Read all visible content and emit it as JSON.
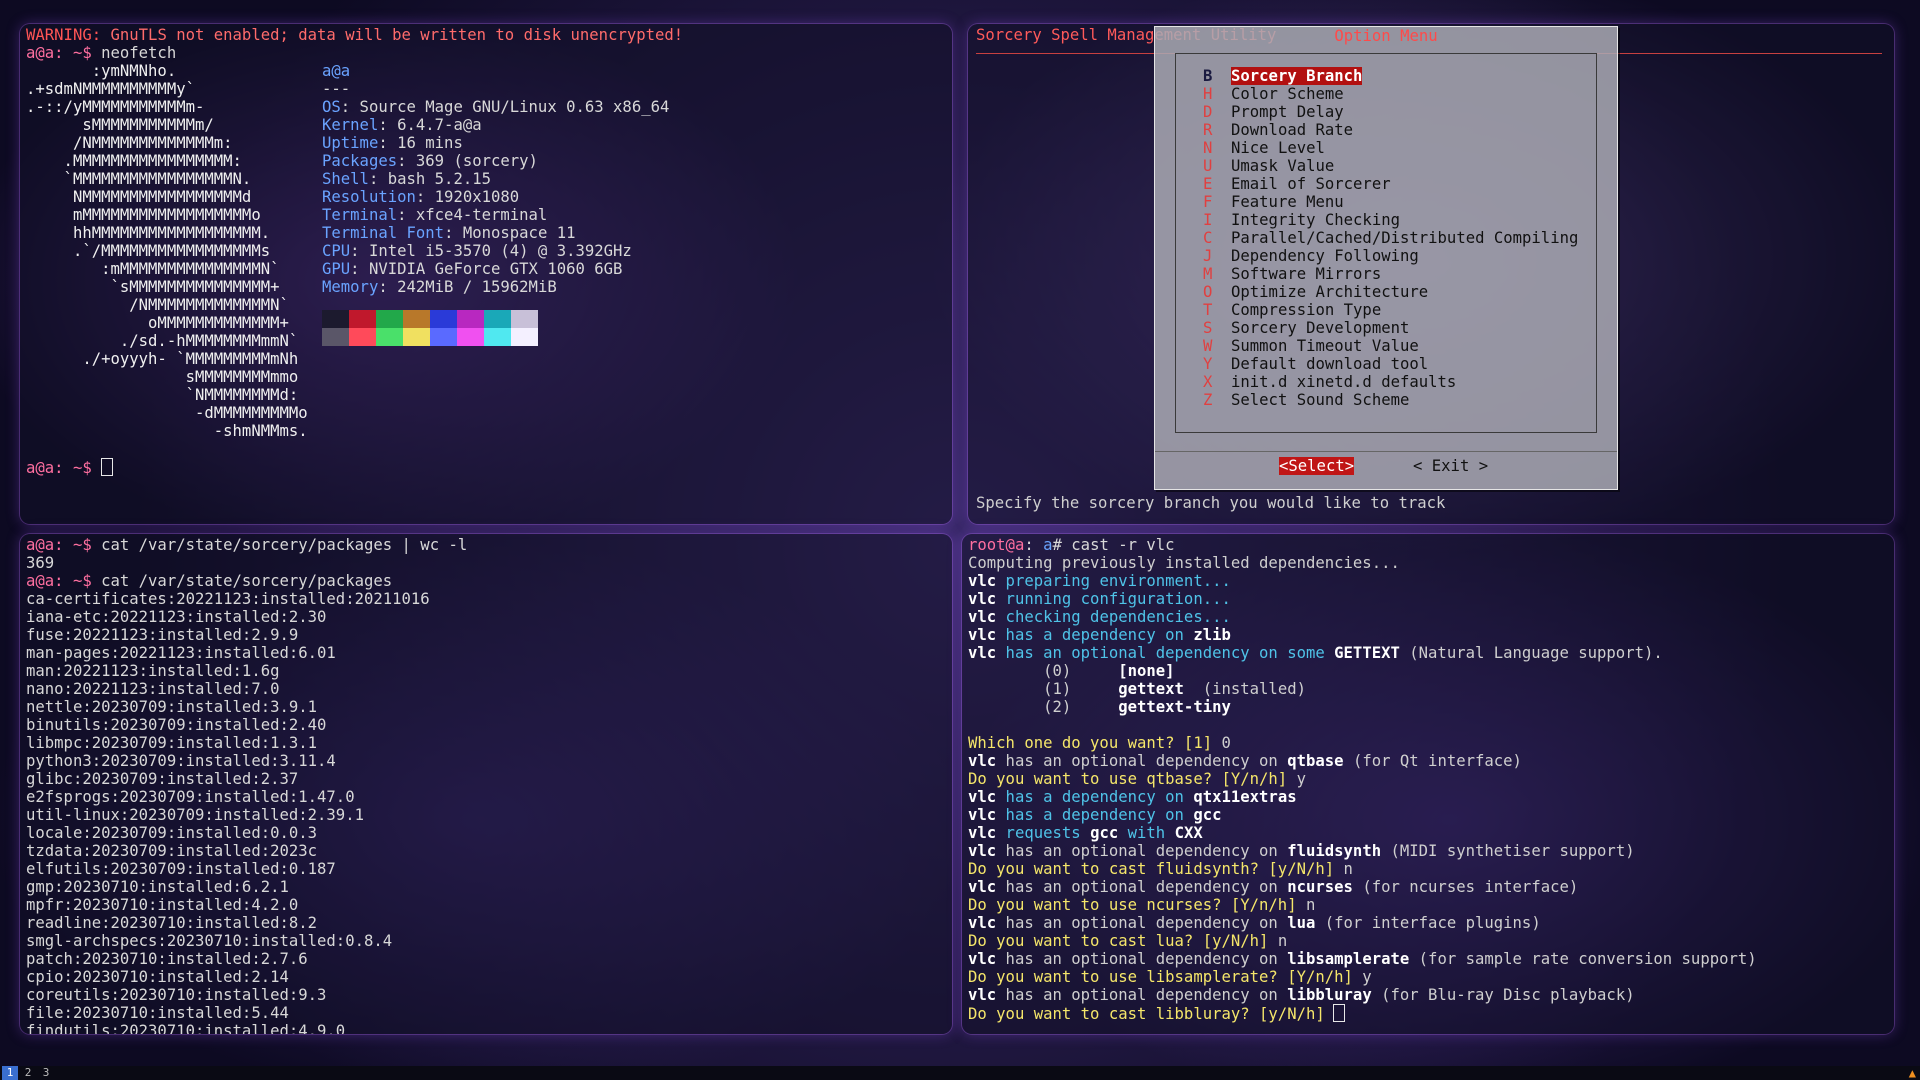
{
  "top_left": {
    "warning_label": "WARNING:",
    "warning_text": " GnuTLS not enabled; data will be written to disk unencrypted!",
    "prompt": "a@a: ~$",
    "command": " neofetch",
    "art": [
      "       :ymNMNho.",
      ".+sdmNMMMMMMMMMMy`",
      ".-::/yMMMMMMMMMMMm-",
      "      sMMMMMMMMMMMm/",
      "     /NMMMMMMMMMMMMMm:",
      "    .MMMMMMMMMMMMMMMMM:",
      "    `MMMMMMMMMMMMMMMMMN.",
      "     NMMMMMMMMMMMMMMMMMd",
      "     mMMMMMMMMMMMMMMMMMMo",
      "     hhMMMMMMMMMMMMMMMMMM.",
      "     .`/MMMMMMMMMMMMMMMMMs",
      "        :mMMMMMMMMMMMMMMMN`",
      "         `sMMMMMMMMMMMMMMM+",
      "           /NMMMMMMMMMMMMMN`",
      "             oMMMMMMMMMMMMM+",
      "          ./sd.-hMMMMMMMMmmN`",
      "      ./+oyyyh- `MMMMMMMMMmNh",
      "                 sMMMMMMMMmmo",
      "                 `NMMMMMMMMd:",
      "                  -dMMMMMMMMMo",
      "                    -shmNMMms."
    ],
    "info_host": "a@a",
    "info_sep": "---",
    "info": [
      {
        "k": "OS",
        "v": ": Source Mage GNU/Linux 0.63 x86_64"
      },
      {
        "k": "Kernel",
        "v": ": 6.4.7-a@a"
      },
      {
        "k": "Uptime",
        "v": ": 16 mins"
      },
      {
        "k": "Packages",
        "v": ": 369 (sorcery)"
      },
      {
        "k": "Shell",
        "v": ": bash 5.2.15"
      },
      {
        "k": "Resolution",
        "v": ": 1920x1080"
      },
      {
        "k": "Terminal",
        "v": ": xfce4-terminal"
      },
      {
        "k": "Terminal Font",
        "v": ": Monospace 11"
      },
      {
        "k": "CPU",
        "v": ": Intel i5-3570 (4) @ 3.392GHz"
      },
      {
        "k": "GPU",
        "v": ": NVIDIA GeForce GTX 1060 6GB"
      },
      {
        "k": "Memory",
        "v": ": 242MiB / 15962MiB"
      }
    ],
    "palette_top": [
      "#1c1a2e",
      "#c0182c",
      "#22a84a",
      "#b8782a",
      "#2a3ad8",
      "#b828c0",
      "#1aa8b8",
      "#c8c0d8"
    ],
    "palette_bottom": [
      "#5a5668",
      "#ff4a5a",
      "#4ae06a",
      "#f0e060",
      "#5a6aff",
      "#f050f0",
      "#50e8f0",
      "#f4f0ff"
    ],
    "prompt2": "a@a: ~$"
  },
  "top_right": {
    "header": "Sorcery Spell Management Utility",
    "dialog_title": "Option Menu",
    "menu": [
      {
        "hotkey": "B",
        "label": "Sorcery Branch",
        "selected": true
      },
      {
        "hotkey": "H",
        "label": "Color Scheme"
      },
      {
        "hotkey": "D",
        "label": "Prompt Delay"
      },
      {
        "hotkey": "R",
        "label": "Download Rate"
      },
      {
        "hotkey": "N",
        "label": "Nice Level"
      },
      {
        "hotkey": "U",
        "label": "Umask Value"
      },
      {
        "hotkey": "E",
        "label": "Email of Sorcerer"
      },
      {
        "hotkey": "F",
        "label": "Feature Menu"
      },
      {
        "hotkey": "I",
        "label": "Integrity Checking"
      },
      {
        "hotkey": "C",
        "label": "Parallel/Cached/Distributed Compiling"
      },
      {
        "hotkey": "J",
        "label": "Dependency Following"
      },
      {
        "hotkey": "M",
        "label": "Software Mirrors"
      },
      {
        "hotkey": "O",
        "label": "Optimize Architecture"
      },
      {
        "hotkey": "T",
        "label": "Compression Type"
      },
      {
        "hotkey": "S",
        "label": "Sorcery Development"
      },
      {
        "hotkey": "W",
        "label": "Summon Timeout Value"
      },
      {
        "hotkey": "Y",
        "label": "Default download tool"
      },
      {
        "hotkey": "X",
        "label": "init.d xinetd.d defaults"
      },
      {
        "hotkey": "Z",
        "label": "Select Sound Scheme"
      }
    ],
    "select_button": "<Select>",
    "exit_button": "< Exit >",
    "help_text": "Specify the sorcery branch you would like to track"
  },
  "bottom_left": {
    "prompt": "a@a: ~$",
    "cmd1": " cat /var/state/sorcery/packages | wc -l",
    "count": "369",
    "cmd2": " cat /var/state/sorcery/packages",
    "packages": [
      "ca-certificates:20221123:installed:20211016",
      "iana-etc:20221123:installed:2.30",
      "fuse:20221123:installed:2.9.9",
      "man-pages:20221123:installed:6.01",
      "man:20221123:installed:1.6g",
      "nano:20221123:installed:7.0",
      "nettle:20230709:installed:3.9.1",
      "binutils:20230709:installed:2.40",
      "libmpc:20230709:installed:1.3.1",
      "python3:20230709:installed:3.11.4",
      "glibc:20230709:installed:2.37",
      "e2fsprogs:20230709:installed:1.47.0",
      "util-linux:20230709:installed:2.39.1",
      "locale:20230709:installed:0.0.3",
      "tzdata:20230709:installed:2023c",
      "elfutils:20230709:installed:0.187",
      "gmp:20230710:installed:6.2.1",
      "mpfr:20230710:installed:4.2.0",
      "readline:20230710:installed:8.2",
      "smgl-archspecs:20230710:installed:0.8.4",
      "patch:20230710:installed:2.7.6",
      "cpio:20230710:installed:2.14",
      "coreutils:20230710:installed:9.3",
      "file:20230710:installed:5.44",
      "findutils:20230710:installed:4.9.0"
    ]
  },
  "bottom_right": {
    "root_prompt_user": "root@a",
    "root_prompt_sep": ":",
    "root_prompt_path": " a",
    "root_prompt_end": "#",
    "cmd": " cast -r vlc",
    "lines": [
      [
        {
          "t": "Computing previously installed dependencies...",
          "c": "dim"
        }
      ],
      [
        {
          "t": "vlc",
          "c": "white"
        },
        {
          "t": " preparing environment...",
          "c": "cyan"
        }
      ],
      [
        {
          "t": "vlc",
          "c": "white"
        },
        {
          "t": " running configuration...",
          "c": "cyan"
        }
      ],
      [
        {
          "t": "vlc",
          "c": "white"
        },
        {
          "t": " checking dependencies...",
          "c": "cyan"
        }
      ],
      [
        {
          "t": "vlc",
          "c": "white"
        },
        {
          "t": " has a dependency on ",
          "c": "cyan"
        },
        {
          "t": "zlib",
          "c": "white"
        }
      ],
      [
        {
          "t": "vlc",
          "c": "white"
        },
        {
          "t": " has an optional dependency on some ",
          "c": "cyan"
        },
        {
          "t": "GETTEXT",
          "c": "white"
        },
        {
          "t": " (Natural Language support).",
          "c": "dim"
        }
      ],
      [
        {
          "t": "        (0)     ",
          "c": "dim"
        },
        {
          "t": "[none]",
          "c": "white"
        }
      ],
      [
        {
          "t": "        (1)     ",
          "c": "dim"
        },
        {
          "t": "gettext",
          "c": "white"
        },
        {
          "t": "  (installed)",
          "c": "dim"
        }
      ],
      [
        {
          "t": "        (2)     ",
          "c": "dim"
        },
        {
          "t": "gettext-tiny",
          "c": "white"
        }
      ],
      [
        {
          "t": "",
          "c": "dim"
        }
      ],
      [
        {
          "t": "Which one do you want? [1]",
          "c": "yellow"
        },
        {
          "t": " 0",
          "c": "dim"
        }
      ],
      [
        {
          "t": "vlc",
          "c": "white"
        },
        {
          "t": " has an optional dependency on ",
          "c": "dim"
        },
        {
          "t": "qtbase",
          "c": "white"
        },
        {
          "t": " (for Qt interface)",
          "c": "dim"
        }
      ],
      [
        {
          "t": "Do you want to use qtbase? [Y/n/h]",
          "c": "yellow"
        },
        {
          "t": " y",
          "c": "dim"
        }
      ],
      [
        {
          "t": "vlc",
          "c": "white"
        },
        {
          "t": " has a dependency on ",
          "c": "cyan"
        },
        {
          "t": "qtx11extras",
          "c": "white"
        }
      ],
      [
        {
          "t": "vlc",
          "c": "white"
        },
        {
          "t": " has a dependency on ",
          "c": "cyan"
        },
        {
          "t": "gcc",
          "c": "white"
        }
      ],
      [
        {
          "t": "vlc",
          "c": "white"
        },
        {
          "t": " requests ",
          "c": "cyan"
        },
        {
          "t": "gcc",
          "c": "white"
        },
        {
          "t": " with ",
          "c": "cyan"
        },
        {
          "t": "CXX",
          "c": "white"
        }
      ],
      [
        {
          "t": "vlc",
          "c": "white"
        },
        {
          "t": " has an optional dependency on ",
          "c": "dim"
        },
        {
          "t": "fluidsynth",
          "c": "white"
        },
        {
          "t": " (MIDI synthetiser support)",
          "c": "dim"
        }
      ],
      [
        {
          "t": "Do you want to cast fluidsynth? [y/N/h]",
          "c": "yellow"
        },
        {
          "t": " n",
          "c": "dim"
        }
      ],
      [
        {
          "t": "vlc",
          "c": "white"
        },
        {
          "t": " has an optional dependency on ",
          "c": "dim"
        },
        {
          "t": "ncurses",
          "c": "white"
        },
        {
          "t": " (for ncurses interface)",
          "c": "dim"
        }
      ],
      [
        {
          "t": "Do you want to use ncurses? [Y/n/h]",
          "c": "yellow"
        },
        {
          "t": " n",
          "c": "dim"
        }
      ],
      [
        {
          "t": "vlc",
          "c": "white"
        },
        {
          "t": " has an optional dependency on ",
          "c": "dim"
        },
        {
          "t": "lua",
          "c": "white"
        },
        {
          "t": " (for interface plugins)",
          "c": "dim"
        }
      ],
      [
        {
          "t": "Do you want to cast lua? [y/N/h]",
          "c": "yellow"
        },
        {
          "t": " n",
          "c": "dim"
        }
      ],
      [
        {
          "t": "vlc",
          "c": "white"
        },
        {
          "t": " has an optional dependency on ",
          "c": "dim"
        },
        {
          "t": "libsamplerate",
          "c": "white"
        },
        {
          "t": " (for sample rate conversion support)",
          "c": "dim"
        }
      ],
      [
        {
          "t": "Do you want to use libsamplerate? [Y/n/h]",
          "c": "yellow"
        },
        {
          "t": " y",
          "c": "dim"
        }
      ],
      [
        {
          "t": "vlc",
          "c": "white"
        },
        {
          "t": " has an optional dependency on ",
          "c": "dim"
        },
        {
          "t": "libbluray",
          "c": "white"
        },
        {
          "t": " (for Blu-ray Disc playback)",
          "c": "dim"
        }
      ],
      [
        {
          "t": "Do you want to cast libbluray? [y/N/h]",
          "c": "yellow"
        }
      ]
    ]
  },
  "taskbar": {
    "workspaces": [
      "1",
      "2",
      "3"
    ],
    "active_workspace": "1",
    "tray_icon": "alert-icon"
  }
}
